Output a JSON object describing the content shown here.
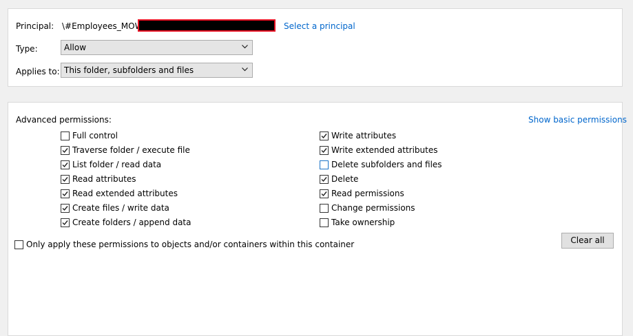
{
  "principal": {
    "label": "Principal:",
    "value": "\\#Employees_MOW",
    "select_link": "Select a principal"
  },
  "type": {
    "label": "Type:",
    "value": "Allow"
  },
  "applies_to": {
    "label": "Applies to:",
    "value": "This folder, subfolders and files"
  },
  "advanced": {
    "title": "Advanced permissions:",
    "show_basic_link": "Show basic permissions",
    "left": [
      {
        "label": "Full control",
        "checked": false
      },
      {
        "label": "Traverse folder / execute file",
        "checked": true
      },
      {
        "label": "List folder / read data",
        "checked": true
      },
      {
        "label": "Read attributes",
        "checked": true
      },
      {
        "label": "Read extended attributes",
        "checked": true
      },
      {
        "label": "Create files / write data",
        "checked": true
      },
      {
        "label": "Create folders / append data",
        "checked": true
      }
    ],
    "right": [
      {
        "label": "Write attributes",
        "checked": true
      },
      {
        "label": "Write extended attributes",
        "checked": true
      },
      {
        "label": "Delete subfolders and files",
        "checked": false
      },
      {
        "label": "Delete",
        "checked": true
      },
      {
        "label": "Read permissions",
        "checked": true
      },
      {
        "label": "Change permissions",
        "checked": false
      },
      {
        "label": "Take ownership",
        "checked": false
      }
    ]
  },
  "only_apply": {
    "label": "Only apply these permissions to objects and/or containers within this container",
    "checked": false
  },
  "clear_all_label": "Clear all"
}
